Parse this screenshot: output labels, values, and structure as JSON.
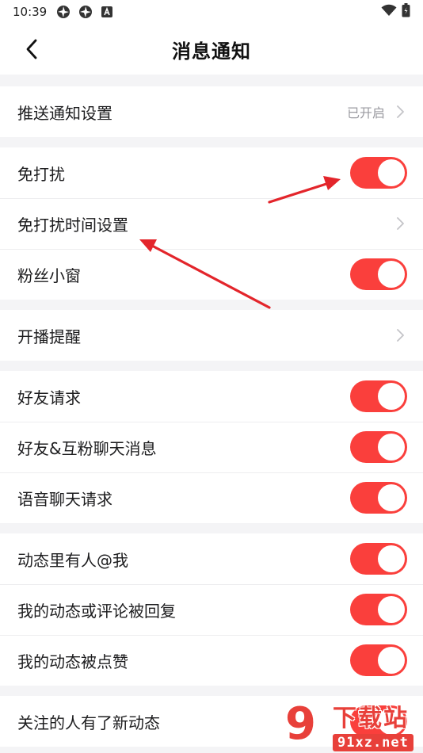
{
  "status_bar": {
    "time": "10:39",
    "icons": [
      "app-pinwheel-icon",
      "app-pinwheel-icon",
      "a-badge-icon"
    ],
    "right_icons": [
      "wifi-icon",
      "battery-icon"
    ]
  },
  "header": {
    "title": "消息通知",
    "back_icon": "chevron-left-icon"
  },
  "groups": [
    {
      "rows": [
        {
          "label": "推送通知设置",
          "value": "已开启",
          "control": "chevron"
        }
      ]
    },
    {
      "rows": [
        {
          "label": "免打扰",
          "control": "toggle",
          "on": true
        },
        {
          "label": "免打扰时间设置",
          "control": "chevron"
        },
        {
          "label": "粉丝小窗",
          "control": "toggle",
          "on": true
        }
      ]
    },
    {
      "rows": [
        {
          "label": "开播提醒",
          "control": "chevron"
        }
      ]
    },
    {
      "rows": [
        {
          "label": "好友请求",
          "control": "toggle",
          "on": true
        },
        {
          "label": "好友&互粉聊天消息",
          "control": "toggle",
          "on": true
        },
        {
          "label": "语音聊天请求",
          "control": "toggle",
          "on": true
        }
      ]
    },
    {
      "rows": [
        {
          "label": "动态里有人@我",
          "control": "toggle",
          "on": true
        },
        {
          "label": "我的动态或评论被回复",
          "control": "toggle",
          "on": true
        },
        {
          "label": "我的动态被点赞",
          "control": "toggle",
          "on": true
        }
      ]
    },
    {
      "rows": [
        {
          "label": "关注的人有了新动态",
          "control": "toggle",
          "on": true
        }
      ]
    }
  ],
  "annotation_color": "#e3252b",
  "toggle_color": "#fa3f3c",
  "watermark": {
    "logo": "9",
    "text": "下载站",
    "domain": "91xz.net"
  }
}
